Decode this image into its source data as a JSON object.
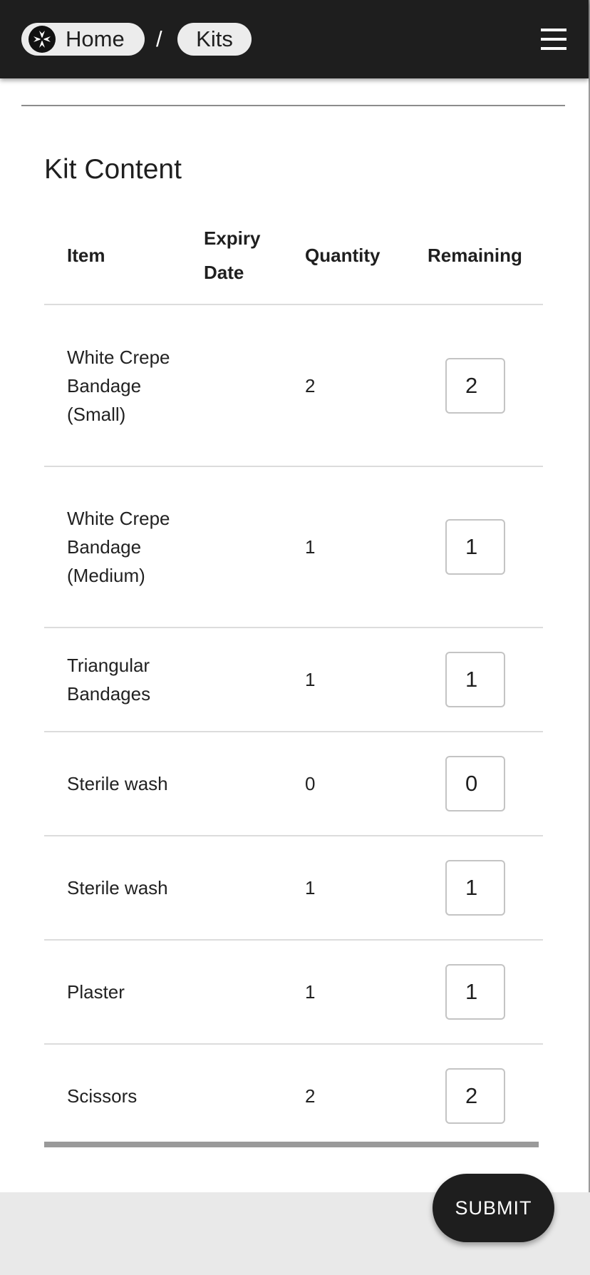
{
  "breadcrumb": {
    "home_label": "Home",
    "separator": "/",
    "current_label": "Kits"
  },
  "header": {
    "menu_icon": "hamburger-menu-icon",
    "home_icon": "st-john-cross-icon"
  },
  "kit": {
    "title": "Kit Content",
    "columns": {
      "item": "Item",
      "expiry_line1": "Expiry",
      "expiry_line2": "Date",
      "quantity": "Quantity",
      "remaining": "Remaining"
    },
    "rows": [
      {
        "item": "White Crepe Bandage (Small)",
        "expiry": "",
        "quantity": "2",
        "remaining": "2"
      },
      {
        "item": "White Crepe Bandage (Medium)",
        "expiry": "",
        "quantity": "1",
        "remaining": "1"
      },
      {
        "item": "Triangular Bandages",
        "expiry": "",
        "quantity": "1",
        "remaining": "1"
      },
      {
        "item": "Sterile wash",
        "expiry": "",
        "quantity": "0",
        "remaining": "0"
      },
      {
        "item": "Sterile wash",
        "expiry": "",
        "quantity": "1",
        "remaining": "1"
      },
      {
        "item": "Plaster",
        "expiry": "",
        "quantity": "1",
        "remaining": "1"
      },
      {
        "item": "Scissors",
        "expiry": "",
        "quantity": "2",
        "remaining": "2"
      }
    ]
  },
  "actions": {
    "submit_label": "SUBMIT"
  },
  "colors": {
    "appbar": "#1e1e1e",
    "page_background": "#e9e9e9",
    "card": "#ffffff",
    "chip": "#ececec"
  }
}
